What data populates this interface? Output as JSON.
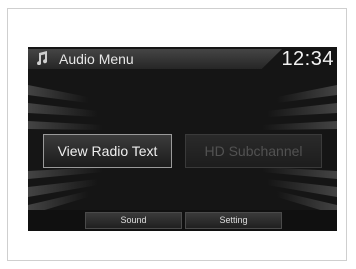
{
  "header": {
    "icon": "music-note-icon",
    "title": "Audio Menu",
    "clock": "12:34"
  },
  "buttons": {
    "view_radio_text": "View Radio Text",
    "hd_subchannel": "HD Subchannel"
  },
  "bottom_bar": {
    "sound": "Sound",
    "setting": "Setting"
  },
  "colors": {
    "screen_background": "#151515",
    "text_primary": "#efefef",
    "text_disabled": "#525252"
  }
}
